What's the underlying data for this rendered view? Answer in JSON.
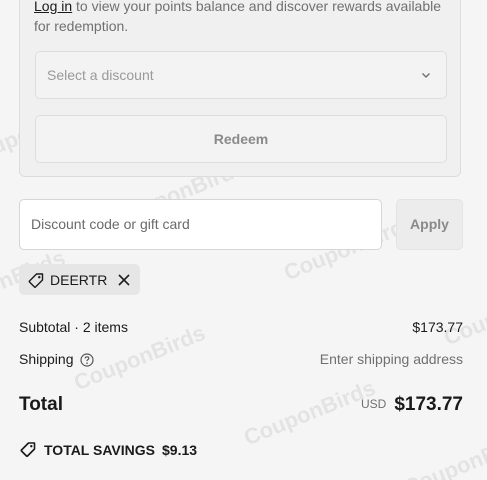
{
  "watermark": "CouponBirds",
  "rewards": {
    "login_link": "Log in",
    "login_text": " to view your points balance and discover rewards available for redemption.",
    "select_placeholder": "Select a discount",
    "redeem_label": "Redeem"
  },
  "discount": {
    "placeholder": "Discount code or gift card",
    "apply_label": "Apply",
    "applied_code": "DEERTR"
  },
  "summary": {
    "subtotal_label": "Subtotal · 2 items",
    "subtotal_value": "$173.77",
    "shipping_label": "Shipping",
    "shipping_value": "Enter shipping address",
    "total_label": "Total",
    "currency": "USD",
    "total_value": "$173.77",
    "savings_label": "TOTAL SAVINGS",
    "savings_value": "$9.13"
  }
}
